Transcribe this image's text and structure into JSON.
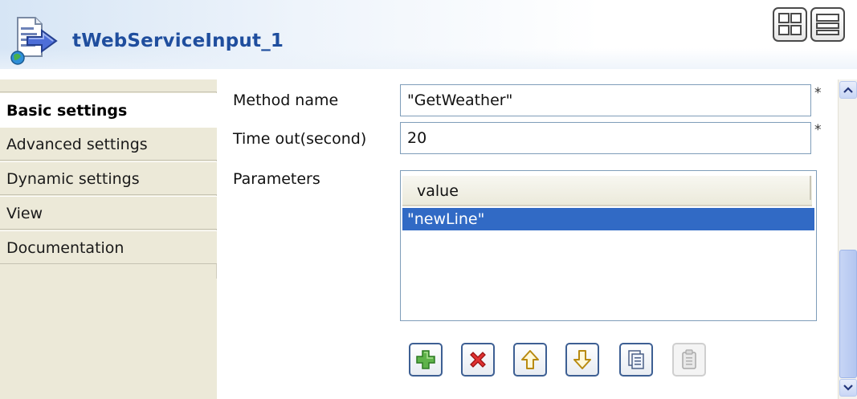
{
  "header": {
    "component_icon": "web-service-input-icon",
    "title": "tWebServiceInput_1",
    "layout_buttons": [
      "grid-layout-icon",
      "list-layout-icon"
    ]
  },
  "tabs": [
    {
      "label": "Basic settings",
      "active": true
    },
    {
      "label": "Advanced settings",
      "active": false
    },
    {
      "label": "Dynamic settings",
      "active": false
    },
    {
      "label": "View",
      "active": false
    },
    {
      "label": "Documentation",
      "active": false
    }
  ],
  "form": {
    "method_name": {
      "label": "Method name",
      "value": "\"GetWeather\"",
      "required": "*"
    },
    "timeout": {
      "label": "Time out(second)",
      "value": "20",
      "required": "*"
    },
    "parameters": {
      "label": "Parameters",
      "columns": [
        "value"
      ],
      "rows": [
        [
          "\"newLine\""
        ]
      ]
    }
  },
  "toolbar": [
    "add-icon",
    "delete-icon",
    "move-up-icon",
    "move-down-icon",
    "copy-icon",
    "paste-icon"
  ],
  "colors": {
    "title": "#1f4e9e",
    "selection": "#316ac5",
    "tab_bg": "#ece9d8"
  }
}
